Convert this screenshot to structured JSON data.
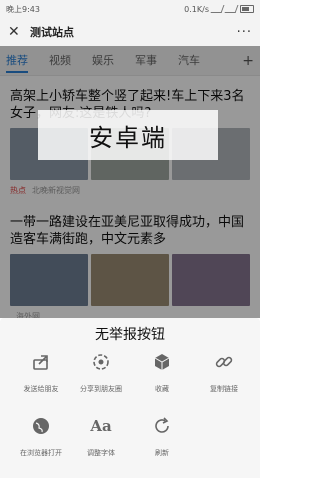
{
  "status_bar": {
    "time": "晚上9:43",
    "network_speed": "0.1K/s"
  },
  "header": {
    "title": "测试站点",
    "close_icon": "close-icon",
    "more_label": "···"
  },
  "tabs": [
    {
      "label": "推荐",
      "active": true
    },
    {
      "label": "视频",
      "active": false
    },
    {
      "label": "娱乐",
      "active": false
    },
    {
      "label": "军事",
      "active": false
    },
    {
      "label": "汽车",
      "active": false
    }
  ],
  "tab_add_label": "+",
  "articles": [
    {
      "title": "高架上小轿车整个竖了起来!车上下来3名女子，网友:这是铁人吗?",
      "tag": "热点",
      "source": "北晚新视觉网"
    },
    {
      "title": "一带一路建设在亚美尼亚取得成功，中国造客车满街跑，中文元素多",
      "tag": "",
      "source": "海外网"
    }
  ],
  "watermark": "安卓端",
  "sheet": {
    "title": "无举报按钮",
    "actions": [
      {
        "label": "发送给朋友",
        "icon": "share-icon"
      },
      {
        "label": "分享到朋友圈",
        "icon": "moments-icon"
      },
      {
        "label": "收藏",
        "icon": "favorite-cube-icon"
      },
      {
        "label": "复制链接",
        "icon": "link-icon"
      },
      {
        "label": "在浏览器打开",
        "icon": "globe-icon"
      },
      {
        "label": "调整字体",
        "icon": "font-icon"
      },
      {
        "label": "刷新",
        "icon": "refresh-icon"
      }
    ]
  },
  "colors": {
    "accent": "#2a7fd4",
    "hot": "#e04343"
  }
}
